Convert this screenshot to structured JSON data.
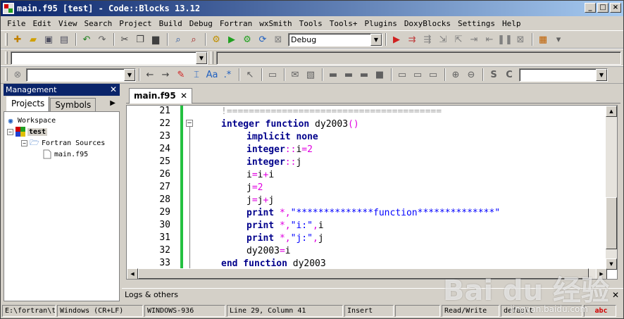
{
  "window": {
    "title": "main.f95 [test] - Code::Blocks 13.12"
  },
  "menu": [
    "File",
    "Edit",
    "View",
    "Search",
    "Project",
    "Build",
    "Debug",
    "Fortran",
    "wxSmith",
    "Tools",
    "Tools+",
    "Plugins",
    "DoxyBlocks",
    "Settings",
    "Help"
  ],
  "toolbar": {
    "build_target": "Debug",
    "icons1": [
      "new-file-icon",
      "open-icon",
      "save-icon",
      "save-all-icon",
      "undo-icon",
      "redo-icon",
      "cut-icon",
      "copy-icon",
      "paste-icon",
      "find-icon",
      "replace-icon"
    ],
    "icons2": [
      "build-icon",
      "run-icon",
      "build-run-icon",
      "rebuild-icon",
      "abort-icon"
    ],
    "icons3": [
      "debug-icon",
      "run-to-cursor-icon",
      "next-line-icon",
      "step-into-icon",
      "step-out-icon",
      "next-instruction-icon",
      "step-into-instruction-icon",
      "break-icon",
      "stop-debug-icon",
      "debug-windows-icon"
    ]
  },
  "management": {
    "title": "Management",
    "tabs": [
      "Projects",
      "Symbols"
    ],
    "tree": {
      "workspace": "Workspace",
      "project": "test",
      "folder": "Fortran Sources",
      "file": "main.f95"
    }
  },
  "editor": {
    "tab": "main.f95",
    "lines": [
      {
        "num": "21"
      },
      {
        "num": "22"
      },
      {
        "num": "23"
      },
      {
        "num": "24"
      },
      {
        "num": "25"
      },
      {
        "num": "26"
      },
      {
        "num": "27"
      },
      {
        "num": "28"
      },
      {
        "num": "29"
      },
      {
        "num": "30"
      },
      {
        "num": "31"
      },
      {
        "num": "32"
      },
      {
        "num": "33"
      }
    ],
    "code": {
      "l21": "!=======================================",
      "l22_kw": "integer function",
      "l22_rest": " dy2003",
      "l22_paren": "()",
      "l23": "implicit none",
      "l24_kw": "integer",
      "l24_op": "::",
      "l24_var": "i",
      "l24_eq": "=",
      "l24_num": "2",
      "l25_kw": "integer",
      "l25_op": "::",
      "l25_var": "j",
      "l26_a": "i",
      "l26_eq": "=",
      "l26_b": "i",
      "l26_plus": "+",
      "l26_c": "i",
      "l27_a": "j",
      "l27_eq": "=",
      "l27_num": "2",
      "l28_a": "j",
      "l28_eq": "=",
      "l28_b": "j",
      "l28_plus": "+",
      "l28_c": "j",
      "l29_kw": "print",
      "l29_op": " *,",
      "l29_str": "\"**************function**************\"",
      "l30_kw": "print",
      "l30_op": " *,",
      "l30_str": "\"i:\"",
      "l30_comma": ",",
      "l30_var": "i",
      "l31_kw": "print",
      "l31_op": " *,",
      "l31_str": "\"j:\"",
      "l31_comma": ",",
      "l31_var": "j",
      "l32_a": "dy2003",
      "l32_eq": "=",
      "l32_b": "i",
      "l33_kw": "end function",
      "l33_rest": " dy2003"
    }
  },
  "logs": {
    "title": "Logs & others"
  },
  "status": {
    "path": "E:\\fortran\\t",
    "eol": "Windows (CR+LF)",
    "encoding": "WINDOWS-936",
    "position": "Line 29, Column 41",
    "mode": "Insert",
    "blank": "",
    "access": "Read/Write",
    "lang": "default"
  },
  "watermark": {
    "brand": "Bai du 经验",
    "url": "jingyan.baidu.com"
  }
}
